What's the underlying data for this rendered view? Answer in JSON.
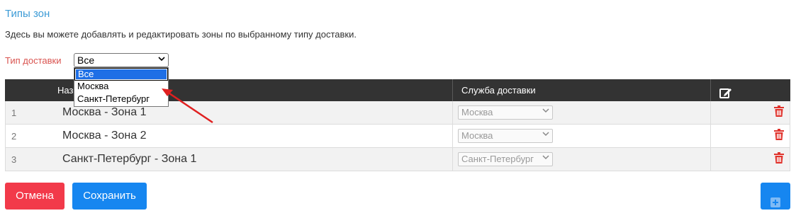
{
  "page": {
    "title": "Типы зон",
    "description": "Здесь вы можете добавлять и редактировать зоны по выбранному типу доставки."
  },
  "filter": {
    "label": "Тип доставки",
    "selected": "Все",
    "options": [
      "Все",
      "Москва",
      "Санкт-Петербург"
    ]
  },
  "table": {
    "columns": [
      "#",
      "Название",
      "Служба доставки",
      "edit-icon"
    ],
    "header_name_visible": "Наз",
    "rows": [
      {
        "num": "1",
        "name": "Москва - Зона 1",
        "service": "Москва"
      },
      {
        "num": "2",
        "name": "Москва - Зона 2",
        "service": "Москва"
      },
      {
        "num": "3",
        "name": "Санкт-Петербург - Зона 1",
        "service": "Санкт-Петербург"
      }
    ]
  },
  "buttons": {
    "cancel": "Отмена",
    "save": "Сохранить",
    "add_icon": "plus-square-icon"
  },
  "colors": {
    "title": "#3c9bd6",
    "label": "#d9534f",
    "header_bg": "#333333",
    "danger": "#f23a4a",
    "primary": "#1686f0",
    "trash": "#e0322b",
    "arrow": "#e02020"
  }
}
